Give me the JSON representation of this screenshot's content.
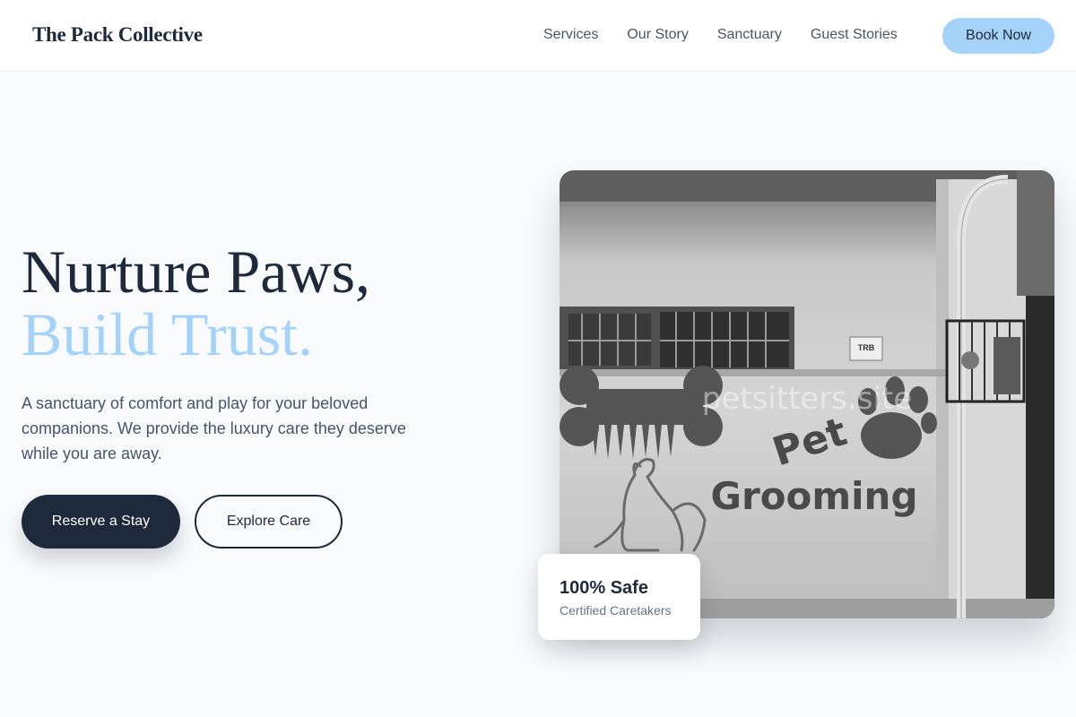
{
  "brand": {
    "name": "The Pack Collective"
  },
  "nav": {
    "items": [
      {
        "label": "Services"
      },
      {
        "label": "Our Story"
      },
      {
        "label": "Sanctuary"
      },
      {
        "label": "Guest Stories"
      }
    ],
    "cta_label": "Book Now"
  },
  "hero": {
    "headline_line1": "Nurture Paws,",
    "headline_line2": "Build Trust.",
    "subtitle": "A sanctuary of comfort and play for your beloved companions. We provide the luxury care they deserve while you are away.",
    "primary_button": "Reserve a Stay",
    "secondary_button": "Explore Care"
  },
  "photo": {
    "alt": "Pet Grooming storefront wall",
    "watermark": "petsitters.site",
    "sign_sticker": "TRB",
    "wall_text_line1": "Pet",
    "wall_text_line2": "Grooming"
  },
  "badge": {
    "title": "100% Safe",
    "subtitle": "Certified Caretakers"
  },
  "colors": {
    "accent": "#a5d2f8",
    "dark": "#1e293b",
    "background": "#f8fafc"
  }
}
